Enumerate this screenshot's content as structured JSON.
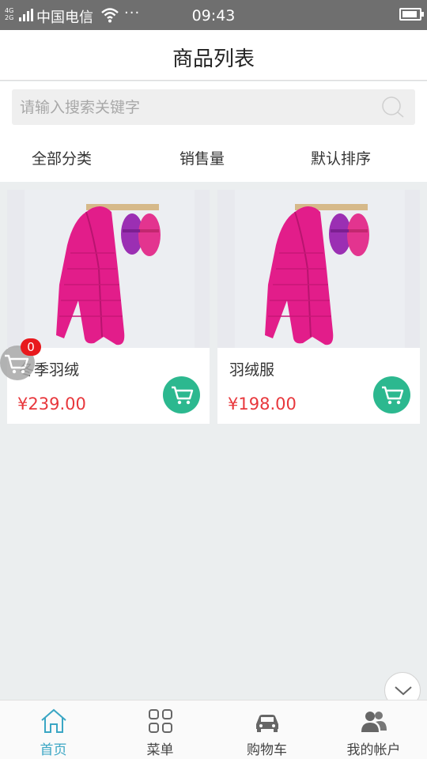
{
  "status_bar": {
    "network": "4G 2G",
    "carrier": "中国电信",
    "dots": "···",
    "time": "09:43"
  },
  "header": {
    "title": "商品列表"
  },
  "search": {
    "placeholder": "请输入搜索关键字",
    "value": ""
  },
  "filters": [
    {
      "label": "全部分类"
    },
    {
      "label": "销售量"
    },
    {
      "label": "默认排序"
    }
  ],
  "products": [
    {
      "name": "冬季羽绒",
      "price": "¥239.00"
    },
    {
      "name": "羽绒服",
      "price": "¥198.00"
    }
  ],
  "floating_cart": {
    "count": "0"
  },
  "tabbar": {
    "items": [
      {
        "label": "首页",
        "icon": "home-icon",
        "active": true
      },
      {
        "label": "菜单",
        "icon": "grid-icon",
        "active": false
      },
      {
        "label": "购物车",
        "icon": "car-icon",
        "active": false
      },
      {
        "label": "我的帐户",
        "icon": "users-icon",
        "active": false
      }
    ]
  },
  "colors": {
    "accent_green": "#2cb88f",
    "price_red": "#e8373c",
    "active_tab": "#3aa6c4",
    "status_bar": "#6f6f6f"
  }
}
